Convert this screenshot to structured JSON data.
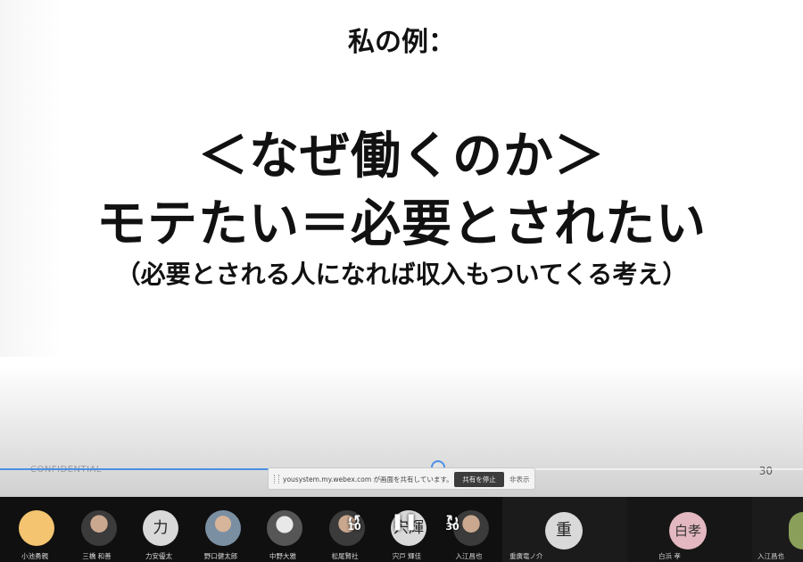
{
  "slide": {
    "heading": "私の例：",
    "line1": "＜なぜ働くのか＞",
    "line2": "モテたい＝必要とされたい",
    "line3": "（必要とされる人になれば収入もついてくる考え）",
    "footer_label": "CONFIDENTIAL",
    "page_number": "30"
  },
  "playback": {
    "progress": 0.546,
    "rewind_seconds": "10",
    "forward_seconds": "30",
    "rewind_icon": "rewind-10-icon",
    "pause_icon": "pause-icon",
    "forward_icon": "forward-30-icon"
  },
  "share_bar": {
    "message": "yousystem.my.webex.com が画面を共有しています。",
    "stop_label": "共有を停止",
    "hide_label": "非表示"
  },
  "participants": [
    {
      "name": "小池勇親",
      "avatar": "cartoon",
      "initial": ""
    },
    {
      "name": "三橋 和善",
      "avatar": "photo",
      "initial": ""
    },
    {
      "name": "力安優太",
      "avatar": "initial",
      "initial": "力"
    },
    {
      "name": "野口健太郎",
      "avatar": "photo2",
      "initial": ""
    },
    {
      "name": "中野大雅",
      "avatar": "photo3",
      "initial": ""
    },
    {
      "name": "松尾賢社",
      "avatar": "photo",
      "initial": ""
    },
    {
      "name": "宍戸 輝佳",
      "avatar": "initial",
      "initial": "宍輝"
    },
    {
      "name": "入江昌也",
      "avatar": "photo",
      "initial": ""
    }
  ],
  "right_participants": [
    {
      "name": "重廣竜ノ介",
      "initial": "重"
    },
    {
      "name": "白浜 孝",
      "initial": "白孝"
    },
    {
      "name": "入江昌也",
      "initial": ""
    }
  ],
  "colors": {
    "accent": "#4a90e2",
    "participant_bar": "#0d0d0d"
  }
}
